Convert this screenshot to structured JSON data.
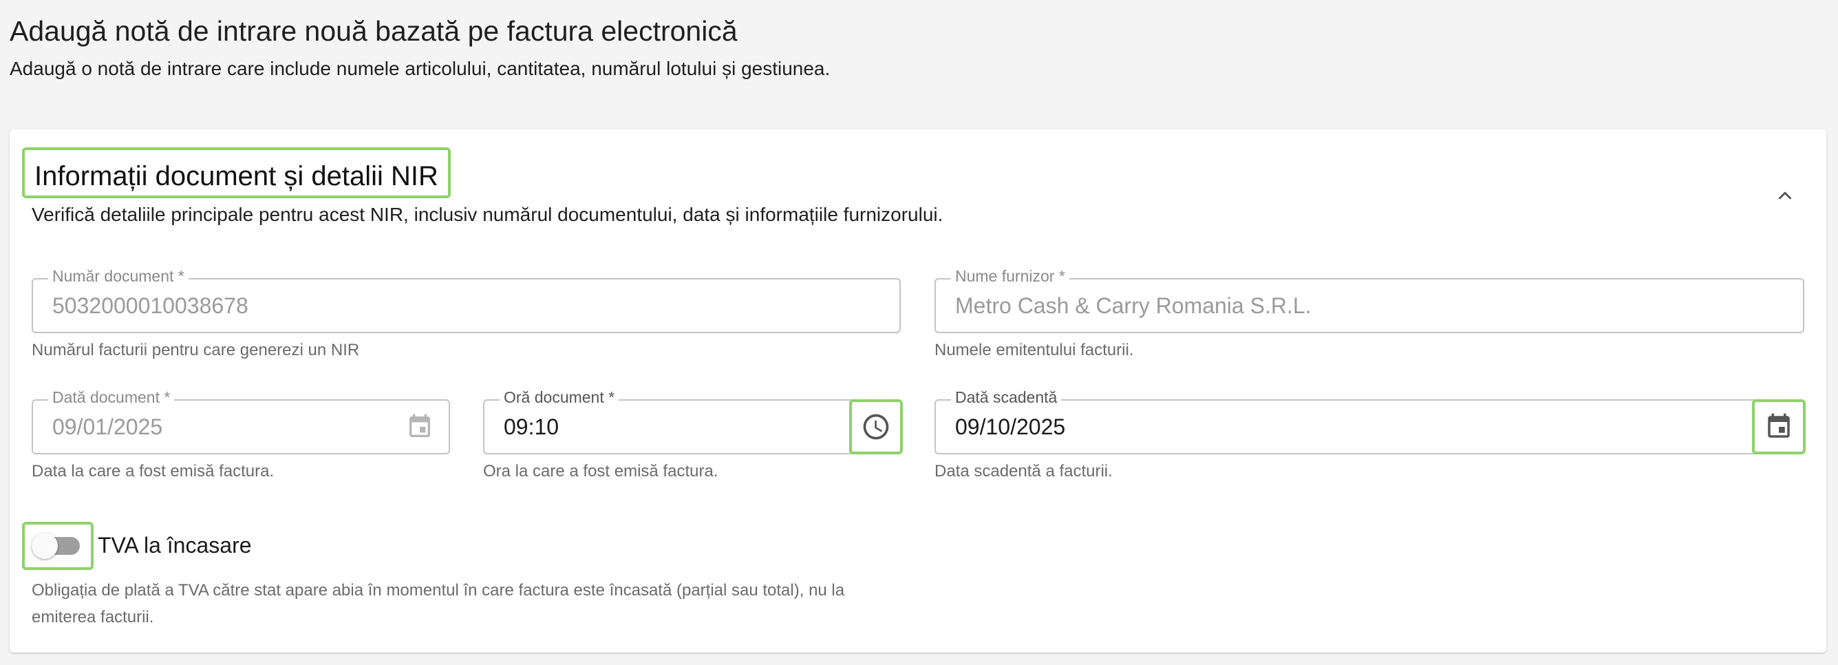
{
  "page": {
    "title": "Adaugă notă de intrare nouă bazată pe factura electronică",
    "subtitle": "Adaugă o notă de intrare care include numele articolului, cantitatea, numărul lotului și gestiunea."
  },
  "section": {
    "title": "Informații document și detalii NIR",
    "description": "Verifică detaliile principale pentru acest NIR, inclusiv numărul documentului, data și informațiile furnizorului.",
    "collapse_icon": "chevron-up-icon"
  },
  "fields": {
    "document_number": {
      "label": "Număr document *",
      "value": "5032000010038678",
      "helper": "Numărul facturii pentru care generezi un NIR"
    },
    "supplier_name": {
      "label": "Nume furnizor *",
      "value": "Metro Cash & Carry Romania S.R.L.",
      "helper": "Numele emitentului facturii."
    },
    "document_date": {
      "label": "Dată document *",
      "value": "09/01/2025",
      "helper": "Data la care a fost emisă factura.",
      "icon": "calendar-icon"
    },
    "document_time": {
      "label": "Oră document *",
      "value": "09:10",
      "helper": "Ora la care a fost emisă factura.",
      "icon": "clock-icon"
    },
    "due_date": {
      "label": "Dată scadentă",
      "value": "09/10/2025",
      "helper": "Data scadentă a facturii.",
      "icon": "calendar-icon"
    }
  },
  "vat_toggle": {
    "label": "TVA la încasare",
    "checked": false,
    "description": "Obligația de plată a TVA către stat apare abia în momentul în care factura este încasată (parțial sau total), nu la emiterea facturii."
  },
  "colors": {
    "highlight": "#8fd16a",
    "border": "#c4c4c4",
    "disabled_text": "#9a9a9a"
  }
}
